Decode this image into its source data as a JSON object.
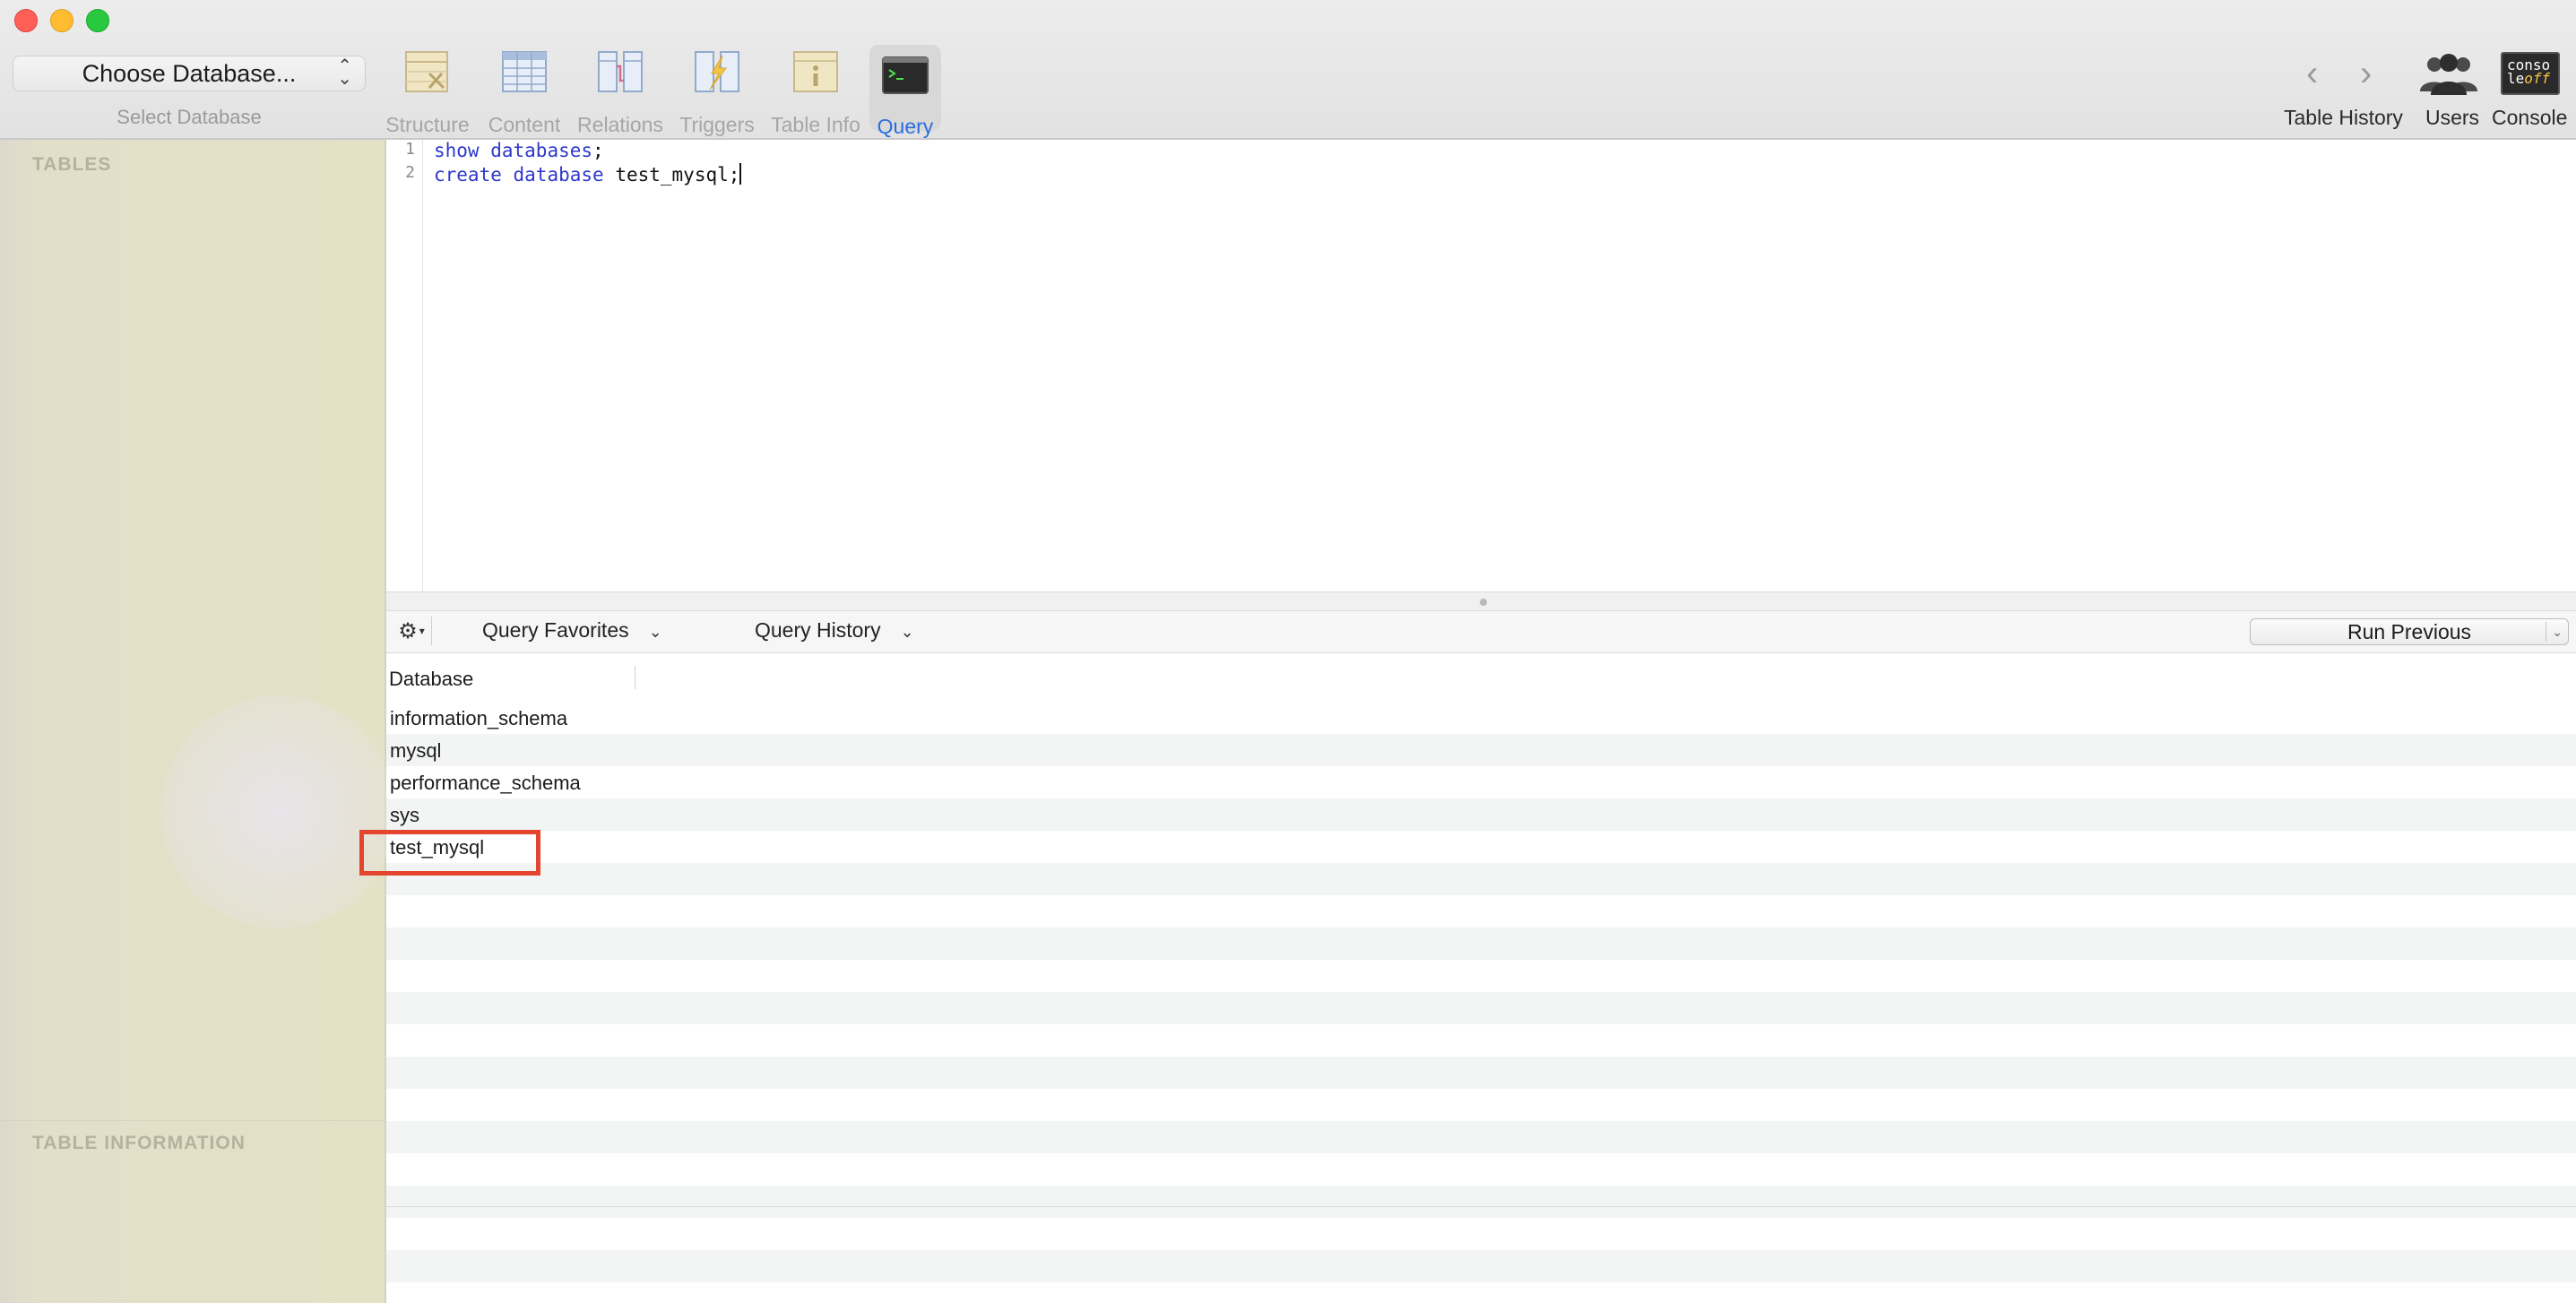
{
  "window": {
    "close_color": "#fe5f57",
    "minimize_color": "#febc2e",
    "zoom_color": "#28c840"
  },
  "toolbar": {
    "database_select": {
      "value": "Choose Database...",
      "caption": "Select Database"
    },
    "tabs": [
      {
        "label": "Structure",
        "icon": "structure-icon",
        "active": false
      },
      {
        "label": "Content",
        "icon": "content-icon",
        "active": false
      },
      {
        "label": "Relations",
        "icon": "relations-icon",
        "active": false
      },
      {
        "label": "Triggers",
        "icon": "triggers-icon",
        "active": false
      },
      {
        "label": "Table Info",
        "icon": "table-info-icon",
        "active": false
      },
      {
        "label": "Query",
        "icon": "terminal-icon",
        "active": true
      }
    ],
    "right": {
      "history_label": "Table History",
      "users_label": "Users",
      "console_label": "Console",
      "console_icon_text": [
        "conso",
        "le",
        "off"
      ]
    },
    "accent_color": "#2b6de0"
  },
  "sidebar": {
    "tables_heading": "TABLES",
    "info_heading": "TABLE INFORMATION"
  },
  "editor": {
    "lines": [
      {
        "number": "1",
        "tokens": [
          {
            "t": "show",
            "kw": true
          },
          {
            "t": " ",
            "kw": false
          },
          {
            "t": "databases",
            "kw": true
          },
          {
            "t": ";",
            "kw": false
          }
        ]
      },
      {
        "number": "2",
        "tokens": [
          {
            "t": "create",
            "kw": true
          },
          {
            "t": " ",
            "kw": false
          },
          {
            "t": "database",
            "kw": true
          },
          {
            "t": " test_mysql;",
            "kw": false
          }
        ]
      }
    ]
  },
  "query_bar": {
    "favorites_label": "Query Favorites",
    "history_label": "Query History",
    "run_label": "Run Previous"
  },
  "results": {
    "column": "Database",
    "rows": [
      "information_schema",
      "mysql",
      "performance_schema",
      "sys",
      "test_mysql"
    ],
    "highlighted_row": "test_mysql",
    "highlight_color": "#e3452f"
  }
}
